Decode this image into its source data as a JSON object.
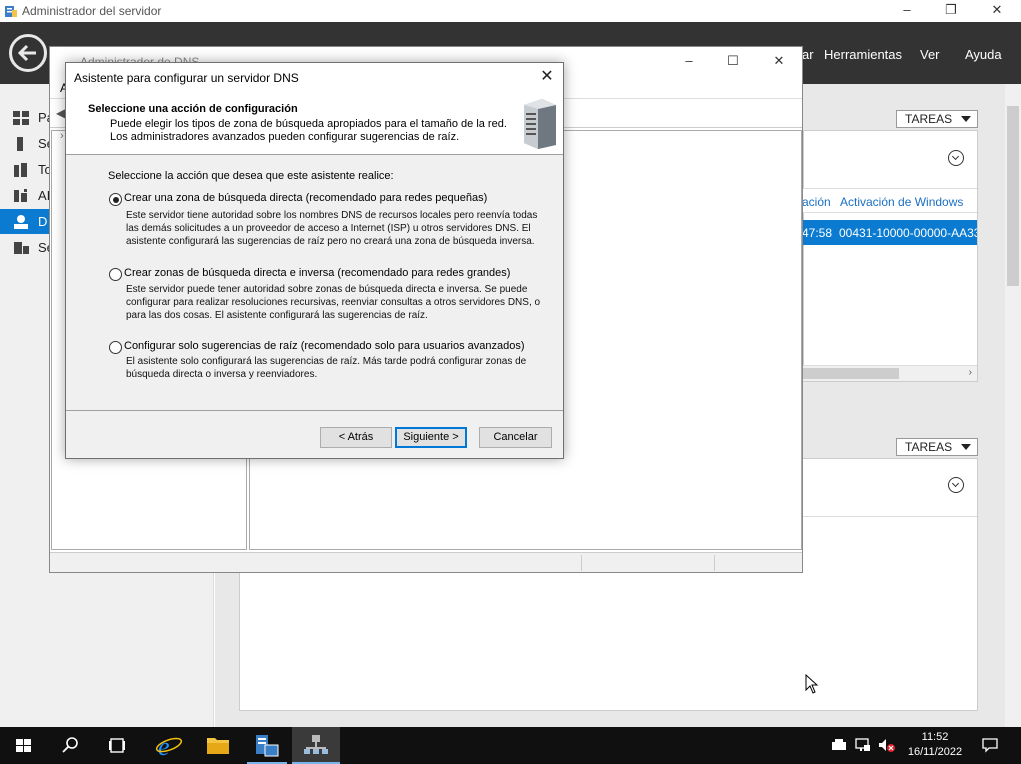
{
  "server_manager": {
    "title": "Administrador del servidor",
    "menu": {
      "herramientas": "Herramientas",
      "ver": "Ver",
      "ayuda": "Ayuda",
      "partial_left": "ar"
    },
    "sidebar": {
      "items": [
        {
          "label": "Pa"
        },
        {
          "label": "Se"
        },
        {
          "label": "To"
        },
        {
          "label": "AI"
        },
        {
          "label": "D"
        },
        {
          "label": "Se"
        }
      ]
    },
    "tasks_label": "TAREAS",
    "table": {
      "col_partial": "ación",
      "col_activation": "Activación de Windows",
      "row_time_partial": "47:58",
      "row_activation": "00431-10000-00000-AA33"
    }
  },
  "dns_manager": {
    "title": "Administrador de DNS",
    "menu_partial": "A"
  },
  "wizard": {
    "title": "Asistente para configurar un servidor DNS",
    "header_title": "Seleccione una acción de configuración",
    "header_desc": "Puede elegir los tipos de zona de búsqueda apropiados para el tamaño de la red. Los administradores avanzados pueden configurar sugerencias de raíz.",
    "prompt": "Seleccione la acción que desea que este asistente realice:",
    "options": [
      {
        "label": "Crear una zona de búsqueda directa (recomendado para redes pequeñas)",
        "desc": "Este servidor tiene autoridad sobre los nombres DNS de recursos locales pero reenvía todas las demás solicitudes a un proveedor de acceso a Internet (ISP) u otros servidores DNS. El asistente configurará las sugerencias de raíz pero no creará una zona de búsqueda inversa.",
        "checked": true
      },
      {
        "label": "Crear zonas de búsqueda directa e inversa (recomendado para redes grandes)",
        "desc": "Este servidor puede tener autoridad sobre zonas de búsqueda directa e inversa. Se puede configurar para realizar resoluciones recursivas, reenviar consultas a otros servidores DNS, o para las dos cosas. El asistente configurará las sugerencias de raíz.",
        "checked": false
      },
      {
        "label": "Configurar solo sugerencias de raíz (recomendado solo para usuarios avanzados)",
        "desc": "El asistente solo configurará las sugerencias de raíz. Más tarde podrá configurar zonas de búsqueda directa o inversa y reenviadores.",
        "checked": false
      }
    ],
    "buttons": {
      "back": "< Atrás",
      "next": "Siguiente >",
      "cancel": "Cancelar"
    }
  },
  "taskbar": {
    "time": "11:52",
    "date": "16/11/2022"
  },
  "colors": {
    "accent": "#0078d7",
    "sidebar_active": "#0a7bd0",
    "header": "#333333",
    "row_selected": "#0a7bd0"
  }
}
